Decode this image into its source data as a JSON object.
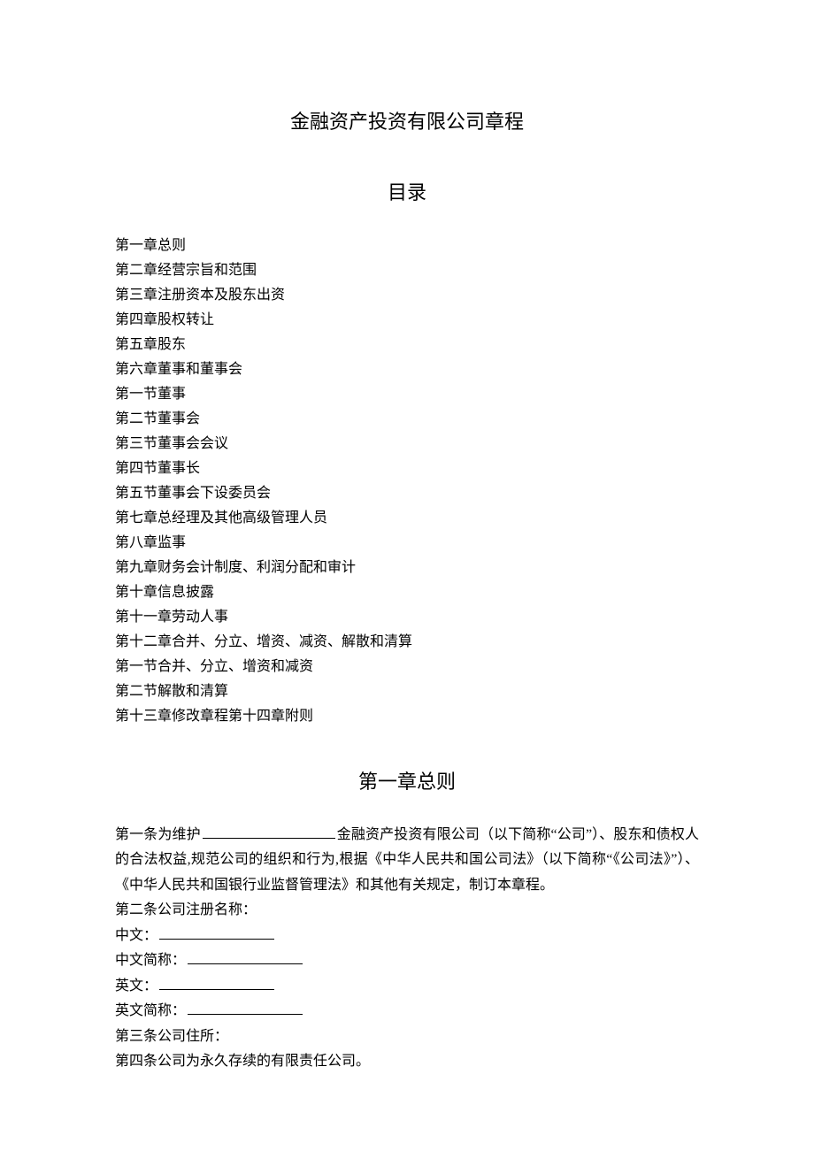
{
  "title": "金融资产投资有限公司章程",
  "toc_header": "目录",
  "toc": [
    "第一章总则",
    "第二章经营宗旨和范围",
    "第三章注册资本及股东出资",
    "第四章股权转让",
    "第五章股东",
    "第六章董事和董事会",
    "第一节董事",
    "第二节董事会",
    "第三节董事会会议",
    "第四节董事长",
    "第五节董事会下设委员会",
    "第七章总经理及其他高级管理人员",
    "第八章监事",
    "第九章财务会计制度、利润分配和审计",
    "第十章信息披露",
    "第十一章劳动人事",
    "第十二章合并、分立、增资、减资、解散和清算",
    "第一节合并、分立、增资和减资",
    "第二节解散和清算",
    "第十三章修改章程第十四章附则"
  ],
  "chapter1": {
    "heading": "第一章总则",
    "art1_a": "第一条为维护",
    "art1_b": "金融资产投资有限公司（以下简称“公司”）、股东和债权人的合法权益,规范公司的组织和行为,根据《中华人民共和国公司法》（以下简称“《公司法》”）、《中华人民共和国银行业监督管理法》和其他有关规定，制订本章程。",
    "art2": "第二条公司注册名称：",
    "cn_label": "中文：",
    "cn_short_label": "中文简称：",
    "en_label": "英文：",
    "en_short_label": "英文简称：",
    "art3": "第三条公司住所：",
    "art4": "第四条公司为永久存续的有限责任公司。"
  }
}
